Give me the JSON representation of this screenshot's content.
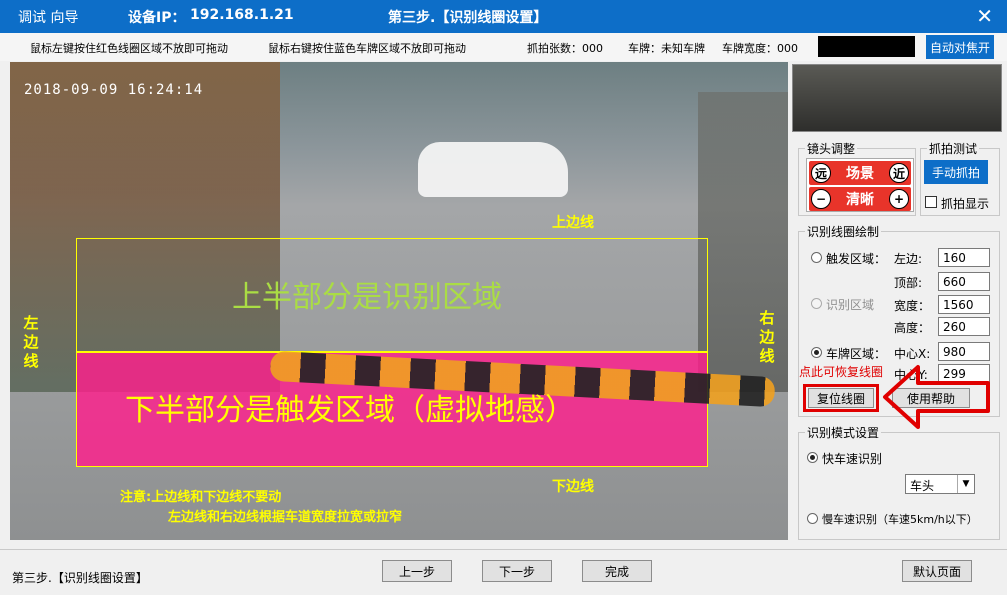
{
  "titlebar": {
    "app": "调试 向导",
    "device_label": "设备IP：",
    "device_ip": "192.168.1.21",
    "step": "第三步.【识别线圈设置】"
  },
  "hints": {
    "left_drag": "鼠标左键按住红色线圈区域不放即可拖动",
    "right_drag": "鼠标右键按住蓝色车牌区域不放即可拖动",
    "capture_count": "抓拍张数：000",
    "plate": "车牌：未知车牌",
    "plate_width": "车牌宽度：000",
    "auto_focus": "自动对焦开"
  },
  "video": {
    "timestamp": "2018-09-09 16:24:14",
    "top_line": "上边线",
    "bottom_line": "下边线",
    "left_line": [
      "左",
      "边",
      "线"
    ],
    "right_line": [
      "右",
      "边",
      "线"
    ],
    "upper_text": "上半部分是识别区域",
    "lower_text": "下半部分是触发区域（虚拟地感）",
    "note1": "注意:上边线和下边线不要动",
    "note2": "左边线和右边线根据车道宽度拉宽或拉窄"
  },
  "lens": {
    "legend": "镜头调整",
    "far": "远",
    "scene": "场景",
    "near": "近",
    "minus": "−",
    "focus": "清晰",
    "plus": "+"
  },
  "capture": {
    "legend": "抓拍测试",
    "manual": "手动抓拍",
    "show": "抓拍显示"
  },
  "coil": {
    "legend": "识别线圈绘制",
    "trigger": "触发区域：",
    "recog": "识别区域",
    "plate": "车牌区域：",
    "left": "左边:",
    "top": "顶部:",
    "width": "宽度：",
    "height": "高度：",
    "cx": "中心X:",
    "cy": "中心Y:",
    "left_val": "160",
    "top_val": "660",
    "width_val": "1560",
    "height_val": "260",
    "cx_val": "980",
    "cy_val": "299",
    "restore_hint": "点此可恢复线圈",
    "reset": "复位线圈",
    "help": "使用帮助"
  },
  "mode": {
    "legend": "识别模式设置",
    "fast": "快车速识别",
    "select": "车头",
    "slow": "慢车速识别（车速5km/h以下）"
  },
  "bottom": {
    "status": "第三步.【识别线圈设置】",
    "prev": "上一步",
    "next": "下一步",
    "done": "完成",
    "default": "默认页面"
  },
  "colors": {
    "title_bg": "#0d6ec8",
    "trigger_zone": "#ff1e8c",
    "line": "#ffff00",
    "warn": "#e00000"
  }
}
